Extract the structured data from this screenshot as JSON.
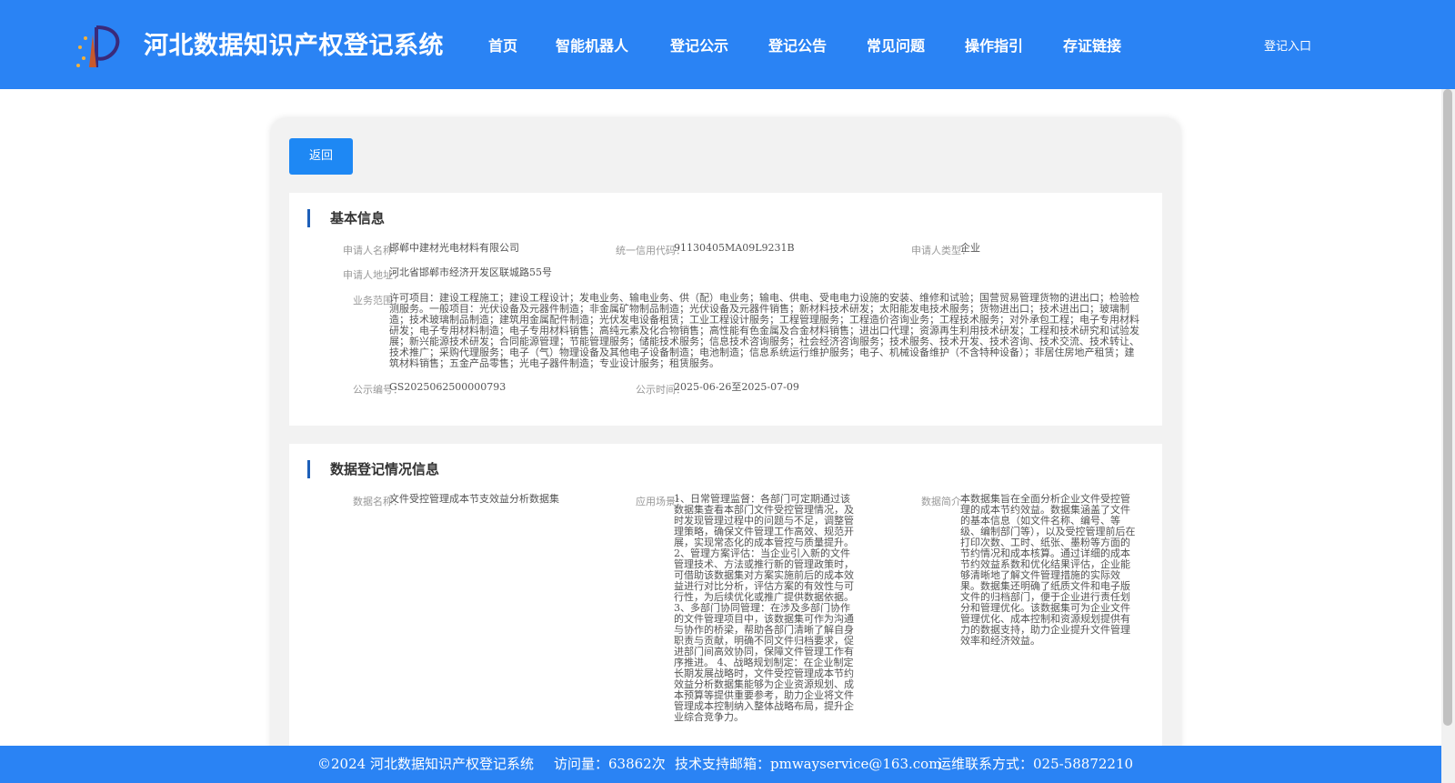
{
  "header": {
    "site_title": "河北数据知识产权登记系统",
    "nav": [
      {
        "label": "首页"
      },
      {
        "label": "智能机器人"
      },
      {
        "label": "登记公示"
      },
      {
        "label": "登记公告"
      },
      {
        "label": "常见问题"
      },
      {
        "label": "操作指引"
      },
      {
        "label": "存证链接"
      }
    ],
    "login": "登记入口"
  },
  "back_button": "返回",
  "basic_info": {
    "title": "基本信息",
    "applicant_name_label": "申请人名称：",
    "applicant_name": "邯郸中建材光电材料有限公司",
    "credit_code_label": "统一信用代码：",
    "credit_code": "91130405MA09L9231B",
    "applicant_type_label": "申请人类型：",
    "applicant_type": "企业",
    "address_label": "申请人地址：",
    "address": "河北省邯郸市经济开发区联城路55号",
    "scope_label": "业务范围：",
    "scope": "许可项目：建设工程施工；建设工程设计；发电业务、输电业务、供（配）电业务；输电、供电、受电电力设施的安装、维修和试验；国营贸易管理货物的进出口；检验检测服务。一般项目：光伏设备及元器件制造；非金属矿物制品制造；光伏设备及元器件销售；新材料技术研发；太阳能发电技术服务；货物进出口；技术进出口；玻璃制造；技术玻璃制品制造；建筑用金属配件制造；光伏发电设备租赁；工业工程设计服务；工程管理服务；工程造价咨询业务；工程技术服务；对外承包工程；电子专用材料研发；电子专用材料制造；电子专用材料销售；高纯元素及化合物销售；高性能有色金属及合金材料销售；进出口代理；资源再生利用技术研发；工程和技术研究和试验发展；新兴能源技术研发；合同能源管理；节能管理服务；储能技术服务；信息技术咨询服务；社会经济咨询服务；技术服务、技术开发、技术咨询、技术交流、技术转让、技术推广；采购代理服务；电子（气）物理设备及其他电子设备制造；电池制造；信息系统运行维护服务；电子、机械设备维护（不含特种设备）；非居住房地产租赁；建筑材料销售；五金产品零售；光电子器件制造；专业设计服务；租赁服务。",
    "pub_no_label": "公示编号：",
    "pub_no": "GS2025062500000793",
    "pub_time_label": "公示时间：",
    "pub_time": "2025-06-26至2025-07-09"
  },
  "data_info": {
    "title": "数据登记情况信息",
    "name_label": "数据名称：",
    "name": "文件受控管理成本节支效益分析数据集",
    "scene_label": "应用场景：",
    "scene": "1、日常管理监督：各部门可定期通过该数据集查看本部门文件受控管理情况，及时发现管理过程中的问题与不足，调整管理策略，确保文件管理工作高效、规范开展，实现常态化的成本管控与质量提升。 2、管理方案评估：当企业引入新的文件管理技术、方法或推行新的管理政策时，可借助该数据集对方案实施前后的成本效益进行对比分析，评估方案的有效性与可行性，为后续优化或推广提供数据依据。 3、多部门协同管理：在涉及多部门协作的文件管理项目中，该数据集可作为沟通与协作的桥梁，帮助各部门清晰了解自身职责与贡献，明确不同文件归档要求，促进部门间高效协同，保障文件管理工作有序推进。 4、战略规划制定：在企业制定长期发展战略时，文件受控管理成本节约效益分析数据集能够为企业资源规划、成本预算等提供重要参考，助力企业将文件管理成本控制纳入整体战略布局，提升企业综合竞争力。",
    "intro_label": "数据简介：",
    "intro": "本数据集旨在全面分析企业文件受控管理的成本节约效益。数据集涵盖了文件的基本信息（如文件名称、编号、等级、编制部门等），以及受控管理前后在打印次数、工时、纸张、墨粉等方面的节约情况和成本核算。通过详细的成本节约效益系数和优化结果评估，企业能够清晰地了解文件管理措施的实际效果。数据集还明确了纸质文件和电子版文件的归档部门，便于企业进行责任划分和管理优化。该数据集可为企业文件管理优化、成本控制和资源规划提供有力的数据支持，助力企业提升文件管理效率和经济效益。"
  },
  "footer": {
    "copyright": "©2024 河北数据知识产权登记系统",
    "visits": "访问量：63862次",
    "email": "技术支持邮箱：pmwayservice@163.com",
    "phone": "运维联系方式：025-58872210"
  }
}
